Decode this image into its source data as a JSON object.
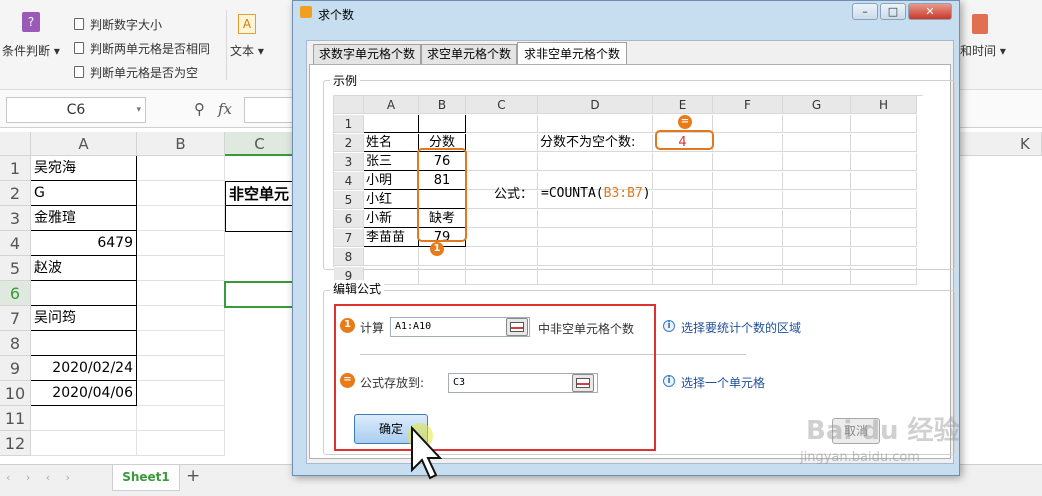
{
  "ribbon": {
    "cond_label": "条件判断",
    "items": [
      "判断数字大小",
      "判断两单元格是否相同",
      "判断单元格是否为空"
    ],
    "text_label": "文本",
    "datetime_label": "和时间"
  },
  "formula_bar": {
    "name_box": "C6",
    "fx": "fx"
  },
  "sheet": {
    "columns": [
      "A",
      "B",
      "C",
      "K"
    ],
    "rows": [
      "1",
      "2",
      "3",
      "4",
      "5",
      "6",
      "7",
      "8",
      "9",
      "10",
      "11",
      "12"
    ],
    "col_a": [
      "吴宛海",
      "G",
      "金雅瑄",
      "6479",
      "赵波",
      "",
      "吴问筠",
      "",
      "2020/02/24",
      "2020/04/06",
      "",
      ""
    ],
    "c2_text": "非空单元",
    "tab_name": "Sheet1",
    "add_tab": "+"
  },
  "dialog": {
    "title": "求个数",
    "tabs": [
      "求数字单元格个数",
      "求空单元格个数",
      "求非空单元格个数"
    ],
    "example": {
      "label": "示例",
      "cols": [
        "",
        "A",
        "B",
        "C",
        "D",
        "E",
        "F",
        "G",
        "H"
      ],
      "rows": [
        "1",
        "2",
        "3",
        "4",
        "5",
        "6",
        "7",
        "8",
        "9"
      ],
      "a": [
        "",
        "姓名",
        "张三",
        "小明",
        "小红",
        "小新",
        "李苗苗",
        "",
        ""
      ],
      "b": [
        "",
        "分数",
        "76",
        "81",
        "",
        "缺考",
        "79",
        "",
        ""
      ],
      "d2": "分数不为空个数:",
      "e2": "4",
      "formula_label": "公式：",
      "formula_prefix": "=COUNTA(",
      "formula_range": "B3:B7",
      "formula_suffix": ")",
      "badge1": "1",
      "badge_eq": "="
    },
    "edit": {
      "label": "编辑公式",
      "calc_label": "计算",
      "range_value": "A1:A10",
      "range_suffix": "中非空单元格个数",
      "range_hint": "选择要统计个数的区域",
      "store_label": "公式存放到:",
      "store_value": "C3",
      "store_hint": "选择一个单元格",
      "badge1": "1",
      "badge_eq": "="
    },
    "ok_label": "确定",
    "cancel_label": "取消"
  },
  "watermark": {
    "brand": "Bai du 经验",
    "url": "jingyan.baidu.com"
  },
  "colors": {
    "orange": "#e07820",
    "red": "#e03030",
    "accent_green": "#3a9a3a"
  }
}
